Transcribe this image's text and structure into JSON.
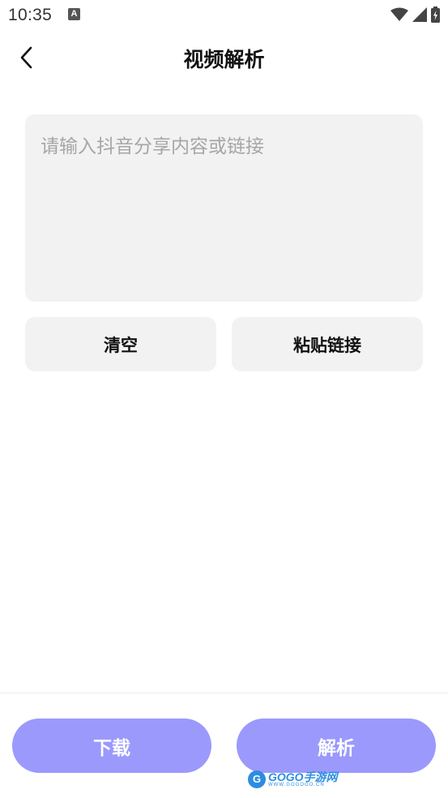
{
  "status_bar": {
    "time": "10:35",
    "notification_icon_letter": "A",
    "icons": [
      "wifi-icon",
      "signal-icon",
      "battery-icon"
    ]
  },
  "header": {
    "back_icon": "chevron-left-icon",
    "title": "视频解析"
  },
  "input": {
    "placeholder": "请输入抖音分享内容或链接",
    "value": ""
  },
  "actions": {
    "clear_label": "清空",
    "paste_label": "粘贴链接"
  },
  "bottom": {
    "download_label": "下载",
    "parse_label": "解析"
  },
  "watermark": {
    "logo_letter": "G",
    "main": "GOGO手游网",
    "sub": "WWW.GOGOGO.CN"
  },
  "colors": {
    "accent": "#9b99fc",
    "panel_bg": "#f2f2f2",
    "placeholder": "#a6a6a6",
    "watermark": "#2d8de0"
  }
}
